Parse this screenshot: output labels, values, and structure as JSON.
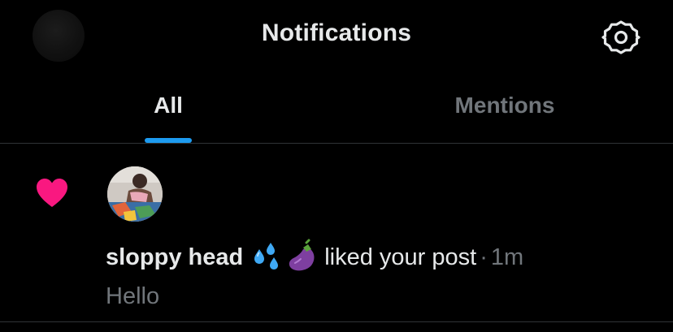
{
  "header": {
    "title": "Notifications"
  },
  "tabs": [
    {
      "label": "All",
      "active": true
    },
    {
      "label": "Mentions",
      "active": false
    }
  ],
  "notification": {
    "type_icon": "heart-icon",
    "username": "sloppy head",
    "emojis": [
      "💦",
      "🍆"
    ],
    "action": "liked your post",
    "separator": "·",
    "time": "1m",
    "post_text": "Hello"
  },
  "colors": {
    "background": "#000000",
    "accent": "#1d9bf0",
    "like": "#f91880",
    "muted": "#71767b",
    "text": "#e7e9ea",
    "divider": "#2f3336"
  }
}
